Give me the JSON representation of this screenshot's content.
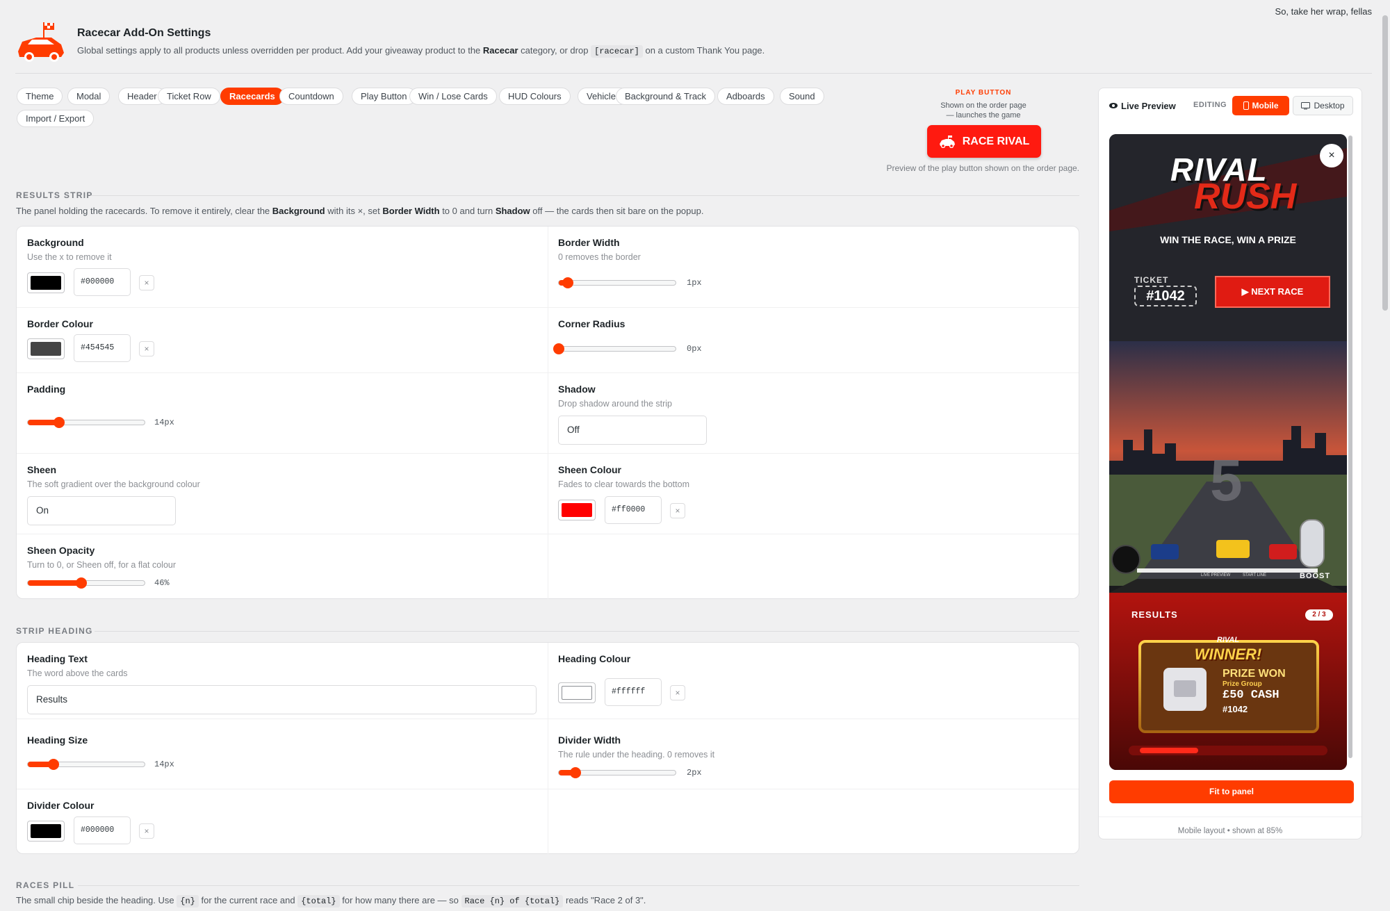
{
  "corner_text": "So, take her wrap, fellas",
  "header": {
    "title": "Racecar Add-On Settings",
    "desc_1": "Global settings apply to all products unless overridden per product. Add your giveaway product to the ",
    "desc_bold": "Racecar",
    "desc_2": " category, or drop ",
    "desc_code": "[racecar]",
    "desc_3": " on a custom Thank You page."
  },
  "tabs": [
    "Theme",
    "Modal",
    "Header",
    "Ticket Row",
    "Racecards",
    "Countdown",
    "Play Button",
    "Win / Lose Cards",
    "HUD Colours",
    "Vehicles",
    "Background & Track",
    "Adboards",
    "Sound",
    "Import / Export"
  ],
  "active_tab": "Racecards",
  "play_button": {
    "label": "PLAY BUTTON",
    "sub_1": "Shown on the order page",
    "sub_2": "— launches the game",
    "button_text": "RACE RIVAL",
    "preview_note": "Preview of the play button shown on the order page."
  },
  "results_strip": {
    "title": "RESULTS STRIP",
    "desc_1": "The panel holding the racecards. To remove it entirely, clear the ",
    "desc_b1": "Background",
    "desc_2": " with its ×, set ",
    "desc_b2": "Border Width",
    "desc_3": " to 0 and turn ",
    "desc_b3": "Shadow",
    "desc_4": " off — the cards then sit bare on the popup.",
    "background": {
      "label": "Background",
      "help": "Use the x to remove it",
      "hex": "#000000",
      "color": "#000000"
    },
    "border_width": {
      "label": "Border Width",
      "help": "0 removes the border",
      "value": "1px",
      "pct": 8
    },
    "border_colour": {
      "label": "Border Colour",
      "hex": "#454545",
      "color": "#454545"
    },
    "corner_radius": {
      "label": "Corner Radius",
      "value": "0px",
      "pct": 0
    },
    "padding": {
      "label": "Padding",
      "value": "14px",
      "pct": 27
    },
    "shadow": {
      "label": "Shadow",
      "help": "Drop shadow around the strip",
      "value": "Off"
    },
    "sheen": {
      "label": "Sheen",
      "help": "The soft gradient over the background colour",
      "value": "On"
    },
    "sheen_colour": {
      "label": "Sheen Colour",
      "help": "Fades to clear towards the bottom",
      "hex": "#ff0000",
      "color": "#ff0000"
    },
    "sheen_opacity": {
      "label": "Sheen Opacity",
      "help": "Turn to 0, or Sheen off, for a flat colour",
      "value": "46%",
      "pct": 46
    }
  },
  "strip_heading": {
    "title": "STRIP HEADING",
    "heading_text": {
      "label": "Heading Text",
      "help": "The word above the cards",
      "value": "Results"
    },
    "heading_colour": {
      "label": "Heading Colour",
      "hex": "#ffffff",
      "color": "#ffffff"
    },
    "heading_size": {
      "label": "Heading Size",
      "value": "14px",
      "pct": 22
    },
    "divider_width": {
      "label": "Divider Width",
      "help": "The rule under the heading. 0 removes it",
      "value": "2px",
      "pct": 14
    },
    "divider_colour": {
      "label": "Divider Colour",
      "hex": "#000000",
      "color": "#000000"
    }
  },
  "races_pill": {
    "title": "RACES PILL",
    "desc_1": "The small chip beside the heading. Use ",
    "code_1": "{n}",
    "desc_2": " for the current race and ",
    "code_2": "{total}",
    "desc_3": " for how many there are — so ",
    "code_3": "Race {n} of {total}",
    "desc_4": " reads \"Race 2 of 3\"."
  },
  "preview": {
    "title": "Live Preview",
    "editing": "EDITING",
    "mobile": "Mobile",
    "desktop": "Desktop",
    "close": "×",
    "game_title_1": "RIVAL",
    "game_title_2": "RUSH",
    "tagline": "WIN THE RACE, WIN A PRIZE",
    "ticket_label": "TICKET",
    "ticket_number": "#1042",
    "next_race": "NEXT RACE",
    "countdown": "5",
    "boost": "BOOST",
    "track_note_1": "LIVE PREVIEW",
    "track_note_2": "START LINE",
    "results_heading": "RESULTS",
    "pill": "2 / 3",
    "winner_small": "RIVAL",
    "winner": "WINNER!",
    "prize_won": "PRIZE WON",
    "prize_group": "Prize Group",
    "prize_value": "£50 CASH",
    "prize_ticket": "#1042",
    "fit_button": "Fit to panel",
    "footer": "Mobile layout • shown at 85%"
  }
}
